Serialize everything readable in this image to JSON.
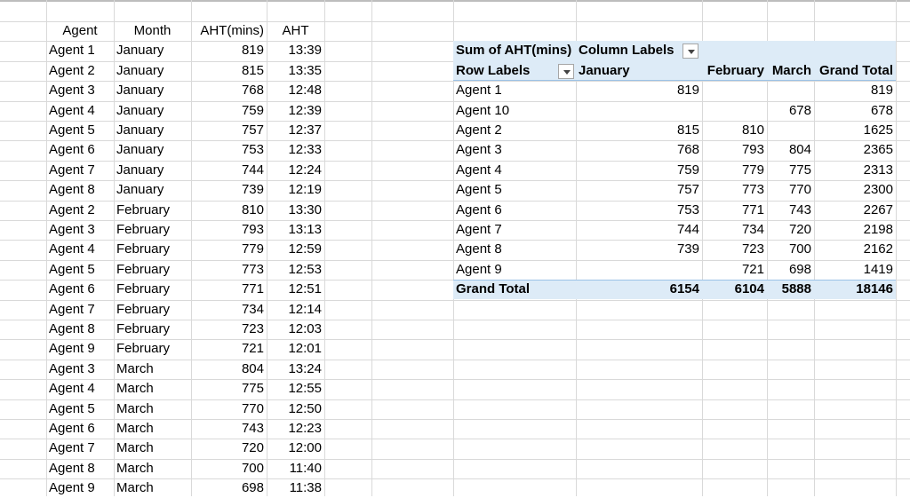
{
  "source_table": {
    "headers": [
      "Agent",
      "Month",
      "AHT(mins)",
      "AHT"
    ],
    "rows": [
      [
        "Agent 1",
        "January",
        "819",
        "13:39"
      ],
      [
        "Agent 2",
        "January",
        "815",
        "13:35"
      ],
      [
        "Agent 3",
        "January",
        "768",
        "12:48"
      ],
      [
        "Agent 4",
        "January",
        "759",
        "12:39"
      ],
      [
        "Agent 5",
        "January",
        "757",
        "12:37"
      ],
      [
        "Agent 6",
        "January",
        "753",
        "12:33"
      ],
      [
        "Agent 7",
        "January",
        "744",
        "12:24"
      ],
      [
        "Agent 8",
        "January",
        "739",
        "12:19"
      ],
      [
        "Agent 2",
        "February",
        "810",
        "13:30"
      ],
      [
        "Agent 3",
        "February",
        "793",
        "13:13"
      ],
      [
        "Agent 4",
        "February",
        "779",
        "12:59"
      ],
      [
        "Agent 5",
        "February",
        "773",
        "12:53"
      ],
      [
        "Agent 6",
        "February",
        "771",
        "12:51"
      ],
      [
        "Agent 7",
        "February",
        "734",
        "12:14"
      ],
      [
        "Agent 8",
        "February",
        "723",
        "12:03"
      ],
      [
        "Agent 9",
        "February",
        "721",
        "12:01"
      ],
      [
        "Agent 3",
        "March",
        "804",
        "13:24"
      ],
      [
        "Agent 4",
        "March",
        "775",
        "12:55"
      ],
      [
        "Agent 5",
        "March",
        "770",
        "12:50"
      ],
      [
        "Agent 6",
        "March",
        "743",
        "12:23"
      ],
      [
        "Agent 7",
        "March",
        "720",
        "12:00"
      ],
      [
        "Agent 8",
        "March",
        "700",
        "11:40"
      ],
      [
        "Agent 9",
        "March",
        "698",
        "11:38"
      ]
    ]
  },
  "pivot": {
    "value_field": "Sum of AHT(mins)",
    "column_labels": "Column Labels",
    "row_labels": "Row Labels",
    "columns": [
      "January",
      "February",
      "March",
      "Grand Total"
    ],
    "rows": [
      [
        "Agent 1",
        "819",
        "",
        "",
        "819"
      ],
      [
        "Agent 10",
        "",
        "",
        "678",
        "678"
      ],
      [
        "Agent 2",
        "815",
        "810",
        "",
        "1625"
      ],
      [
        "Agent 3",
        "768",
        "793",
        "804",
        "2365"
      ],
      [
        "Agent 4",
        "759",
        "779",
        "775",
        "2313"
      ],
      [
        "Agent 5",
        "757",
        "773",
        "770",
        "2300"
      ],
      [
        "Agent 6",
        "753",
        "771",
        "743",
        "2267"
      ],
      [
        "Agent 7",
        "744",
        "734",
        "720",
        "2198"
      ],
      [
        "Agent 8",
        "739",
        "723",
        "700",
        "2162"
      ],
      [
        "Agent 9",
        "",
        "721",
        "698",
        "1419"
      ]
    ],
    "grand_total": [
      "Grand Total",
      "6154",
      "6104",
      "5888",
      "18146"
    ],
    "colors": {
      "band": "#ddebf7",
      "rule": "#9bc2e6"
    }
  }
}
